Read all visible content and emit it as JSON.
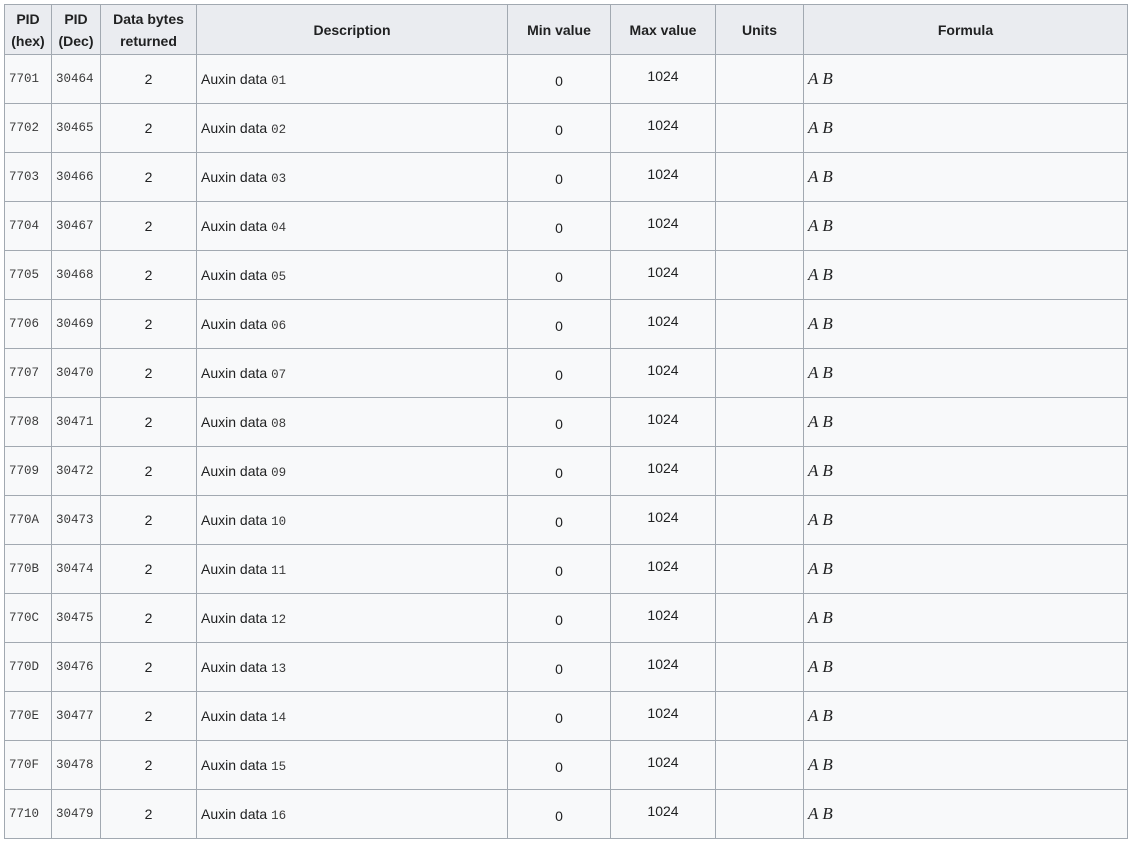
{
  "headers": {
    "pid_hex": "PID (hex)",
    "pid_dec": "PID (Dec)",
    "data_bytes": "Data bytes returned",
    "description": "Description",
    "min_value": "Min value",
    "max_value": "Max value",
    "units": "Units",
    "formula": "Formula"
  },
  "rows": [
    {
      "hex": "7701",
      "dec": "30464",
      "bytes": "2",
      "desc_text": "Auxin data",
      "desc_num": "01",
      "min": "0",
      "max": "1024",
      "units": "",
      "formula": "A B"
    },
    {
      "hex": "7702",
      "dec": "30465",
      "bytes": "2",
      "desc_text": "Auxin data",
      "desc_num": "02",
      "min": "0",
      "max": "1024",
      "units": "",
      "formula": "A B"
    },
    {
      "hex": "7703",
      "dec": "30466",
      "bytes": "2",
      "desc_text": "Auxin data",
      "desc_num": "03",
      "min": "0",
      "max": "1024",
      "units": "",
      "formula": "A B"
    },
    {
      "hex": "7704",
      "dec": "30467",
      "bytes": "2",
      "desc_text": "Auxin data",
      "desc_num": "04",
      "min": "0",
      "max": "1024",
      "units": "",
      "formula": "A B"
    },
    {
      "hex": "7705",
      "dec": "30468",
      "bytes": "2",
      "desc_text": "Auxin data",
      "desc_num": "05",
      "min": "0",
      "max": "1024",
      "units": "",
      "formula": "A B"
    },
    {
      "hex": "7706",
      "dec": "30469",
      "bytes": "2",
      "desc_text": "Auxin data",
      "desc_num": "06",
      "min": "0",
      "max": "1024",
      "units": "",
      "formula": "A B"
    },
    {
      "hex": "7707",
      "dec": "30470",
      "bytes": "2",
      "desc_text": "Auxin data",
      "desc_num": "07",
      "min": "0",
      "max": "1024",
      "units": "",
      "formula": "A B"
    },
    {
      "hex": "7708",
      "dec": "30471",
      "bytes": "2",
      "desc_text": "Auxin data",
      "desc_num": "08",
      "min": "0",
      "max": "1024",
      "units": "",
      "formula": "A B"
    },
    {
      "hex": "7709",
      "dec": "30472",
      "bytes": "2",
      "desc_text": "Auxin data",
      "desc_num": "09",
      "min": "0",
      "max": "1024",
      "units": "",
      "formula": "A B"
    },
    {
      "hex": "770A",
      "dec": "30473",
      "bytes": "2",
      "desc_text": "Auxin data",
      "desc_num": "10",
      "min": "0",
      "max": "1024",
      "units": "",
      "formula": "A B"
    },
    {
      "hex": "770B",
      "dec": "30474",
      "bytes": "2",
      "desc_text": "Auxin data",
      "desc_num": "11",
      "min": "0",
      "max": "1024",
      "units": "",
      "formula": "A B"
    },
    {
      "hex": "770C",
      "dec": "30475",
      "bytes": "2",
      "desc_text": "Auxin data",
      "desc_num": "12",
      "min": "0",
      "max": "1024",
      "units": "",
      "formula": "A B"
    },
    {
      "hex": "770D",
      "dec": "30476",
      "bytes": "2",
      "desc_text": "Auxin data",
      "desc_num": "13",
      "min": "0",
      "max": "1024",
      "units": "",
      "formula": "A B"
    },
    {
      "hex": "770E",
      "dec": "30477",
      "bytes": "2",
      "desc_text": "Auxin data",
      "desc_num": "14",
      "min": "0",
      "max": "1024",
      "units": "",
      "formula": "A B"
    },
    {
      "hex": "770F",
      "dec": "30478",
      "bytes": "2",
      "desc_text": "Auxin data",
      "desc_num": "15",
      "min": "0",
      "max": "1024",
      "units": "",
      "formula": "A B"
    },
    {
      "hex": "7710",
      "dec": "30479",
      "bytes": "2",
      "desc_text": "Auxin data",
      "desc_num": "16",
      "min": "0",
      "max": "1024",
      "units": "",
      "formula": "A B"
    }
  ]
}
